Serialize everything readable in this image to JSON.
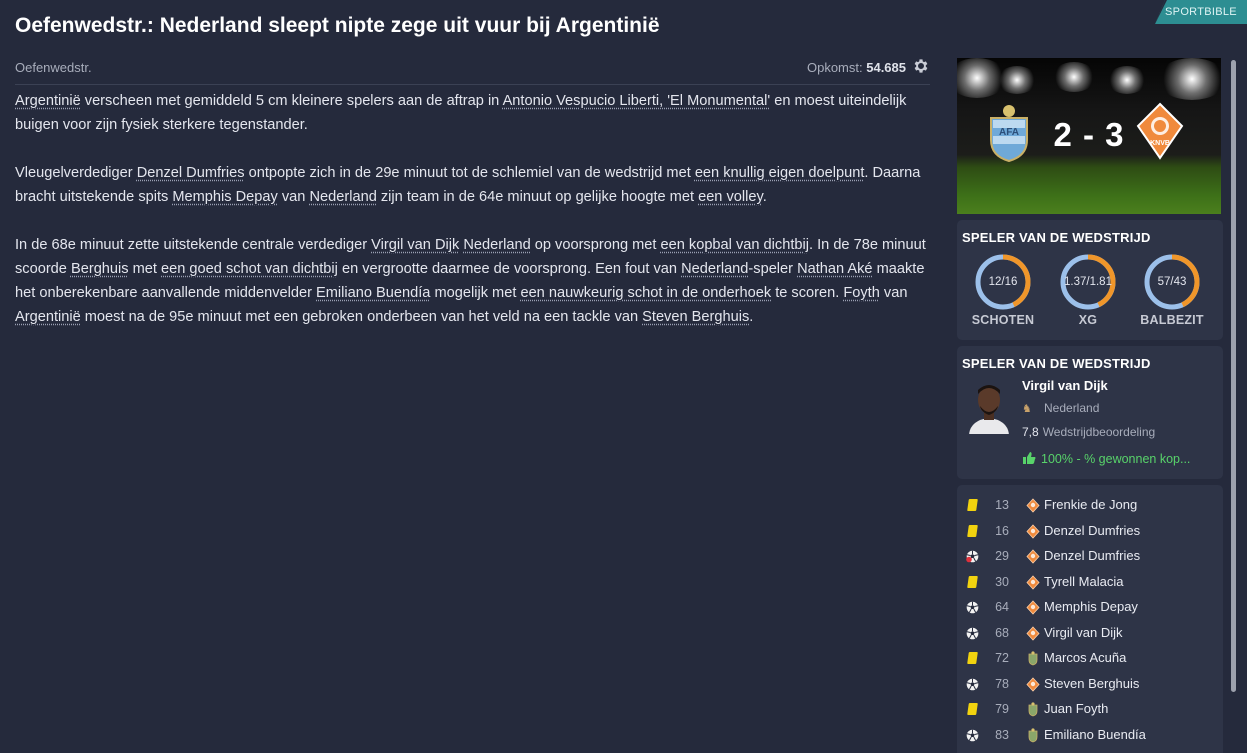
{
  "header": {
    "title": "Oefenwedstr.: Nederland sleept nipte zege uit vuur bij Argentinië",
    "tag": "SPORTBIBLE"
  },
  "subbar": {
    "competition": "Oefenwedstr.",
    "attendance_label": "Opkomst:",
    "attendance_value": "54.685"
  },
  "article": {
    "p1": {
      "s0": "Argentinië",
      "s1": " verscheen met gemiddeld 5 cm kleinere spelers aan de aftrap in ",
      "s2": "Antonio Vespucio Liberti, 'El Monumental'",
      "s3": " en moest uiteindelijk buigen voor zijn fysiek sterkere tegenstander."
    },
    "p2": {
      "s0": "Vleugelverdediger ",
      "s1": "Denzel Dumfries",
      "s2": " ontpopte zich in de 29e minuut tot de schlemiel van de wedstrijd met ",
      "s3": "een knullig eigen doelpunt",
      "s4": ". Daarna bracht uitstekende spits ",
      "s5": "Memphis Depay",
      "s6": " van ",
      "s7": "Nederland",
      "s8": " zijn team in de 64e minuut op gelijke hoogte met ",
      "s9": "een volley",
      "s10": "."
    },
    "p3": {
      "s0": "In de 68e minuut zette uitstekende centrale verdediger ",
      "s1": "Virgil van Dijk",
      "s2": " ",
      "s3": "Nederland",
      "s4": " op voorsprong met ",
      "s5": "een kopbal van dichtbij",
      "s6": ". In de 78e minuut scoorde ",
      "s7": "Berghuis",
      "s8": " met ",
      "s9": "een goed schot van dichtbij",
      "s10": " en vergrootte daarmee de voorsprong. Een fout van ",
      "s11": "Nederland",
      "s12": "-speler ",
      "s13": "Nathan Aké",
      "s14": " maakte het onberekenbare aanvallende middenvelder ",
      "s15": "Emiliano Buendía",
      "s16": " mogelijk met ",
      "s17": "een nauwkeurig schot in de onderhoek",
      "s18": " te scoren. ",
      "s19": "Foyth",
      "s20": " van ",
      "s21": "Argentinië",
      "s22": " moest na de 95e minuut met een gebroken onderbeen van het veld na een tackle van ",
      "s23": "Steven Berghuis",
      "s24": "."
    }
  },
  "scoreboard": {
    "home_team": "Argentinië",
    "away_team": "Nederland",
    "score": "2 - 3",
    "home_crest_text": "AFA",
    "away_crest_text": "KNVB"
  },
  "stats": {
    "heading": "SPELER VAN DE WEDSTRIJD",
    "items": [
      {
        "value": "12/16",
        "label": "SCHOTEN",
        "fraction": 0.43
      },
      {
        "value": "1.37/1.81",
        "label": "XG",
        "fraction": 0.43
      },
      {
        "value": "57/43",
        "label": "BALBEZIT",
        "fraction": 0.43
      }
    ],
    "ring_color": "#f0962a",
    "track_color": "#9cc0ea"
  },
  "potm": {
    "heading": "SPELER VAN DE WEDSTRIJD",
    "name": "Virgil van Dijk",
    "country": "Nederland",
    "rating": "7,8",
    "rating_label": "Wedstrijdbeoordeling",
    "win_text": "100% - % gewonnen kop..."
  },
  "events": [
    {
      "type": "yellow-card",
      "minute": "13",
      "team": "ned",
      "player": "Frenkie de Jong"
    },
    {
      "type": "yellow-card",
      "minute": "16",
      "team": "ned",
      "player": "Denzel Dumfries"
    },
    {
      "type": "own-goal",
      "minute": "29",
      "team": "ned",
      "player": "Denzel Dumfries"
    },
    {
      "type": "yellow-card",
      "minute": "30",
      "team": "ned",
      "player": "Tyrell Malacia"
    },
    {
      "type": "goal",
      "minute": "64",
      "team": "ned",
      "player": "Memphis Depay"
    },
    {
      "type": "goal",
      "minute": "68",
      "team": "ned",
      "player": "Virgil van Dijk"
    },
    {
      "type": "yellow-card",
      "minute": "72",
      "team": "arg",
      "player": "Marcos Acuña"
    },
    {
      "type": "goal",
      "minute": "78",
      "team": "ned",
      "player": "Steven Berghuis"
    },
    {
      "type": "yellow-card",
      "minute": "79",
      "team": "arg",
      "player": "Juan Foyth"
    },
    {
      "type": "goal",
      "minute": "83",
      "team": "arg",
      "player": "Emiliano Buendía"
    }
  ],
  "colors": {
    "background": "#252a3c",
    "card": "#2e3447",
    "accent_tag": "#2d8e92",
    "win_green": "#58d36a",
    "yellow_card": "#f2d30f",
    "ned_orange": "#f08a3c"
  }
}
